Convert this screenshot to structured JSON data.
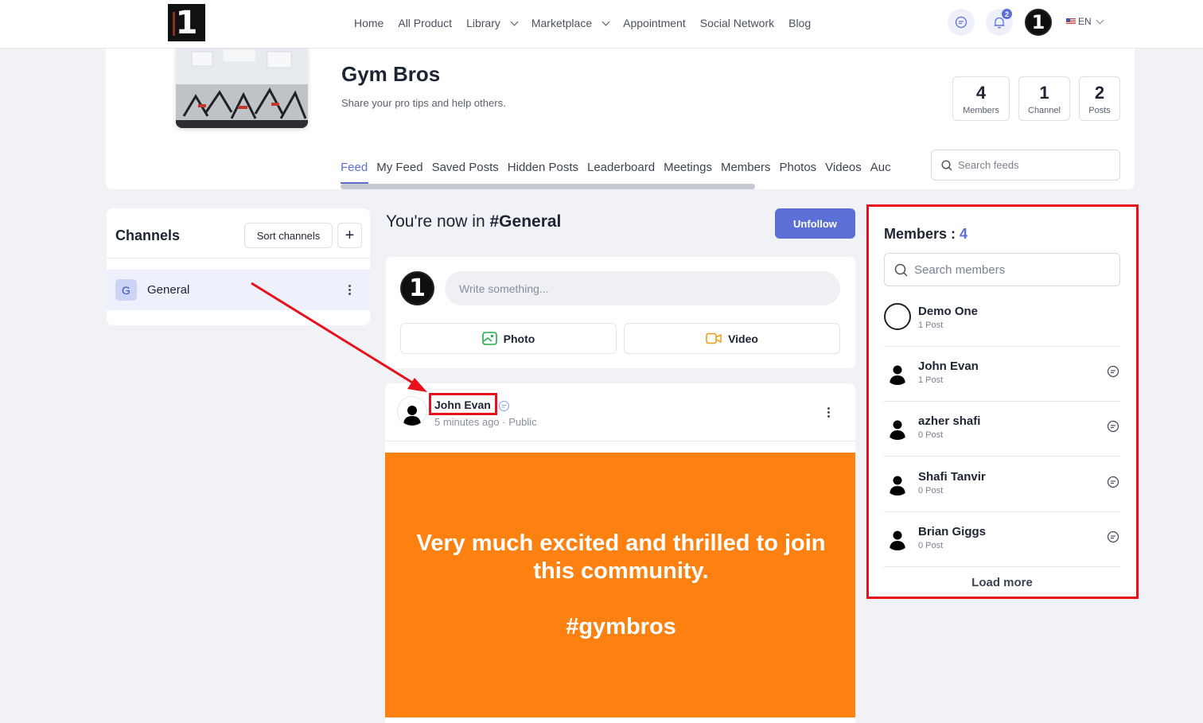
{
  "nav": {
    "links": [
      "Home",
      "All Product",
      "Library",
      "Marketplace",
      "Appointment",
      "Social Network",
      "Blog"
    ],
    "notification_count": "2",
    "language": "EN"
  },
  "group": {
    "title": "Gym Bros",
    "description": "Share your pro tips and help others.",
    "stats": [
      {
        "num": "4",
        "label": "Members"
      },
      {
        "num": "1",
        "label": "Channel"
      },
      {
        "num": "2",
        "label": "Posts"
      }
    ],
    "tabs": [
      "Feed",
      "My Feed",
      "Saved Posts",
      "Hidden Posts",
      "Leaderboard",
      "Meetings",
      "Members",
      "Photos",
      "Videos",
      "Auc"
    ],
    "search_placeholder": "Search feeds"
  },
  "channels": {
    "title": "Channels",
    "sort_label": "Sort channels",
    "add_label": "+",
    "items": [
      {
        "initial": "G",
        "name": "General"
      }
    ]
  },
  "feed": {
    "now_in_prefix": "You're now in ",
    "channel": "#General",
    "unfollow_label": "Unfollow",
    "composer_placeholder": "Write something...",
    "photo_label": "Photo",
    "video_label": "Video"
  },
  "post": {
    "author": "John Evan",
    "meta": "5 minutes ago · Public",
    "text": "Very much excited and thrilled to join\nthis community.\n\n#gymbros",
    "bg_color": "#fd8111"
  },
  "members": {
    "title": "Members : ",
    "count": "4",
    "search_placeholder": "Search members",
    "list": [
      {
        "name": "Demo One",
        "posts": "1 Post"
      },
      {
        "name": "John Evan",
        "posts": "1 Post"
      },
      {
        "name": "azher shafi",
        "posts": "0 Post"
      },
      {
        "name": "Shafi Tanvir",
        "posts": "0 Post"
      },
      {
        "name": "Brian Giggs",
        "posts": "0 Post"
      }
    ],
    "load_more": "Load more"
  },
  "colors": {
    "accent": "#5b6fd6",
    "annotation": "#e8101a"
  }
}
